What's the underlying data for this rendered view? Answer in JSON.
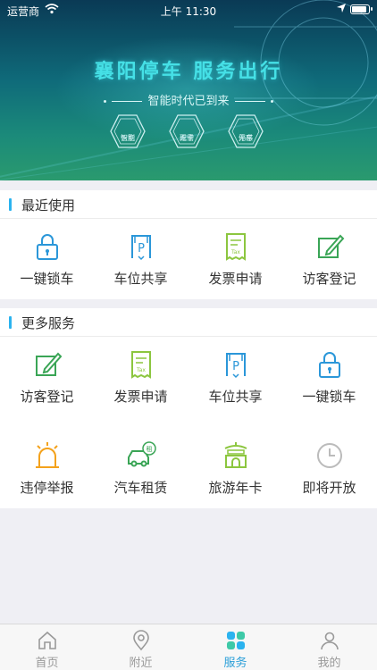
{
  "status_bar": {
    "carrier": "运营商",
    "time": "上午 11:30"
  },
  "banner": {
    "title": "襄阳停车 服务出行",
    "subtitle": "智能时代已到来",
    "badges": [
      {
        "line1": "智能",
        "line2": "识别"
      },
      {
        "line1": "无需",
        "line2": "取卡"
      },
      {
        "line1": "无感",
        "line2": "停车"
      }
    ]
  },
  "recent": {
    "title": "最近使用",
    "items": [
      {
        "label": "一键锁车",
        "icon": "lock-icon"
      },
      {
        "label": "车位共享",
        "icon": "parking-icon"
      },
      {
        "label": "发票申请",
        "icon": "invoice-icon"
      },
      {
        "label": "访客登记",
        "icon": "edit-icon"
      }
    ]
  },
  "more": {
    "title": "更多服务",
    "items": [
      {
        "label": "访客登记",
        "icon": "edit-icon"
      },
      {
        "label": "发票申请",
        "icon": "invoice-icon"
      },
      {
        "label": "车位共享",
        "icon": "parking-icon"
      },
      {
        "label": "一键锁车",
        "icon": "lock-icon"
      },
      {
        "label": "违停举报",
        "icon": "siren-icon"
      },
      {
        "label": "汽车租赁",
        "icon": "car-rental-icon"
      },
      {
        "label": "旅游年卡",
        "icon": "landmark-icon"
      },
      {
        "label": "即将开放",
        "icon": "clock-icon"
      }
    ]
  },
  "tabbar": {
    "tabs": [
      {
        "label": "首页",
        "icon": "home-icon"
      },
      {
        "label": "附近",
        "icon": "location-pin-icon"
      },
      {
        "label": "服务",
        "icon": "services-grid-icon",
        "active": true
      },
      {
        "label": "我的",
        "icon": "user-icon"
      }
    ]
  },
  "colors": {
    "accent": "#2b9fd8",
    "lock_blue": "#2b97d9",
    "green": "#3aa556",
    "lime": "#8cc63f",
    "orange": "#f4a21c",
    "gray": "#999999"
  }
}
